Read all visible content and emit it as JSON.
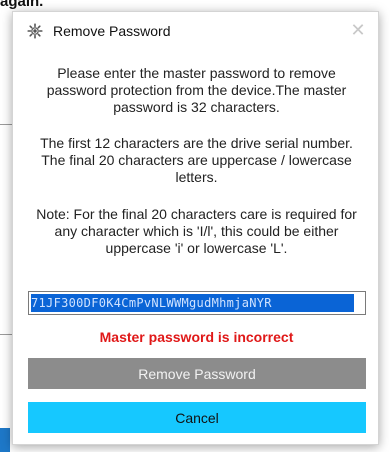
{
  "background": {
    "partial_text": "again."
  },
  "dialog": {
    "title": "Remove Password",
    "icon": "gear-icon",
    "close_glyph": "✕",
    "paragraph_1": "Please enter the master password to remove password protection from the device.The master password is 32 characters.",
    "paragraph_2": "The first 12 characters are the drive serial number. The final 20 characters are uppercase / lowercase letters.",
    "paragraph_3": "Note: For the final 20 characters care is required for any character which is 'I/l', this could be either uppercase 'i' or lowercase 'L'.",
    "password_value": "71JF300DF0K4CmPvNLWWMgudMhmjaNYR",
    "error_message": "Master password is incorrect",
    "remove_button_label": "Remove Password",
    "cancel_button_label": "Cancel"
  },
  "colors": {
    "error": "#e01818",
    "remove_button_bg": "#8c8c8c",
    "cancel_button_bg": "#16c8ff",
    "selection_bg": "#0a64d6"
  }
}
